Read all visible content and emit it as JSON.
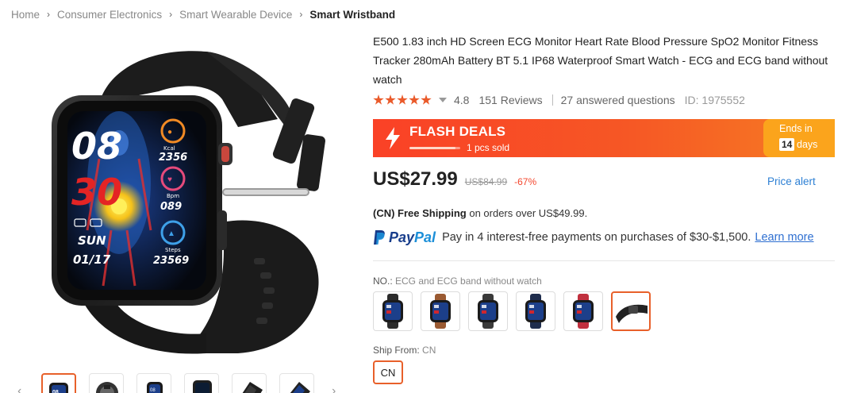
{
  "breadcrumb": {
    "items": [
      "Home",
      "Consumer Electronics",
      "Smart Wearable Device",
      "Smart Wristband"
    ]
  },
  "product": {
    "title": "E500 1.83 inch HD Screen ECG Monitor Heart Rate Blood Pressure SpO2 Monitor Fitness Tracker 280mAh Battery BT 5.1 IP68 Waterproof Smart Watch - ECG and ECG band without watch",
    "rating": "4.8",
    "stars": 5,
    "reviews": "151 Reviews",
    "questions": "27 answered questions",
    "id": "ID: 1975552"
  },
  "watch_face": {
    "hour": "08",
    "minute": "30",
    "kcal": "2356",
    "kcal_label": "Kcal",
    "bpm": "089",
    "bpm_label": "Bpm",
    "steps": "23569",
    "steps_label": "Steps",
    "day": "SUN",
    "date": "01/17"
  },
  "flash_deal": {
    "title": "FLASH DEALS",
    "sold": "1 pcs sold",
    "sold_fraction": 0.9,
    "ends_label": "Ends in",
    "days_num": "14",
    "days_label": "days"
  },
  "price": {
    "current": "US$27.99",
    "original": "US$84.99",
    "discount": "-67%",
    "alert": "Price alert"
  },
  "shipping": {
    "free_label": "(CN) Free Shipping",
    "rest": "on orders over US$49.99."
  },
  "paypal": {
    "brand_pay": "Pay",
    "brand_pal": "Pal",
    "text": "Pay in 4 interest-free payments on purchases of $30-$1,500.",
    "learn_more": "Learn more"
  },
  "variant": {
    "label": "NO.:",
    "selected": "ECG and ECG band without watch",
    "options": [
      {
        "name": "Black silicone band",
        "band_color": "#2b2b2b"
      },
      {
        "name": "Brown leather band",
        "band_color": "#9a5a32"
      },
      {
        "name": "Black steel band",
        "band_color": "#3a3a3a"
      },
      {
        "name": "Blue band",
        "band_color": "#1f2d4d"
      },
      {
        "name": "Red band",
        "band_color": "#c0303e"
      },
      {
        "name": "ECG band without watch",
        "band_color": "#222222"
      }
    ]
  },
  "ship_from": {
    "label": "Ship From:",
    "selected": "CN",
    "option": "CN"
  },
  "colors": {
    "accent": "#e8602a",
    "flash_start": "#fa4126",
    "flash_end": "#f67024",
    "ends_bg": "#fba41c",
    "link": "#2e80d4",
    "star": "#ea5a2a"
  }
}
